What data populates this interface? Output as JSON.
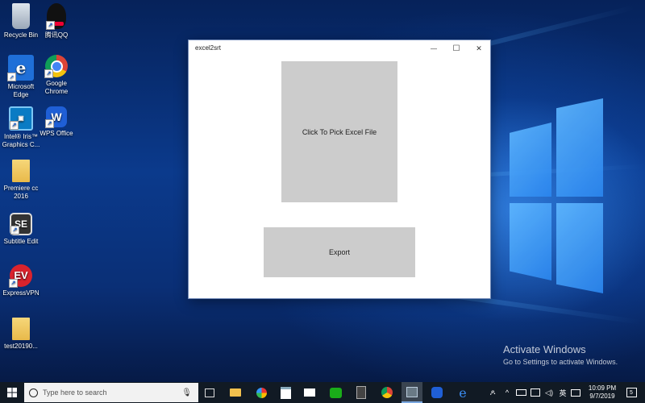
{
  "desktop": {
    "icons": [
      {
        "label": "Recycle Bin",
        "icon": "recycle-bin-icon"
      },
      {
        "label": "腾讯QQ",
        "icon": "qq-icon"
      },
      {
        "label": "Microsoft Edge",
        "icon": "edge-icon"
      },
      {
        "label": "Google Chrome",
        "icon": "chrome-icon"
      },
      {
        "label": "Intel® Iris™ Graphics C...",
        "icon": "intel-graphics-icon"
      },
      {
        "label": "WPS Office",
        "icon": "wps-office-icon"
      },
      {
        "label": "Premiere cc 2016",
        "icon": "folder-icon"
      },
      {
        "label": "Subtitle Edit",
        "icon": "subtitle-edit-icon"
      },
      {
        "label": "ExpressVPN",
        "icon": "expressvpn-icon"
      },
      {
        "label": "test20190...",
        "icon": "folder-icon"
      }
    ]
  },
  "window": {
    "title": "excel2srt",
    "minimize_glyph": "—",
    "maximize_glyph": "☐",
    "close_glyph": "✕",
    "pick_button_label": "Click To Pick Excel File",
    "export_button_label": "Export"
  },
  "watermark": {
    "line1": "Activate Windows",
    "line2": "Go to Settings to activate Windows."
  },
  "taskbar": {
    "search_placeholder": "Type here to search",
    "pinned": [
      "task-view-icon",
      "file-explorer-icon",
      "paint-icon",
      "store-icon",
      "mail-icon",
      "wechat-icon",
      "calculator-icon",
      "chrome-icon",
      "excel2srt-app-icon",
      "wps-icon",
      "edge-icon"
    ],
    "tray": {
      "language": "英",
      "time": "10:09 PM",
      "date": "9/7/2019",
      "notification_count": "5"
    }
  },
  "colors": {
    "taskbar": "#111a24",
    "button_gray": "#cccccc",
    "window_bg": "#ffffff"
  }
}
